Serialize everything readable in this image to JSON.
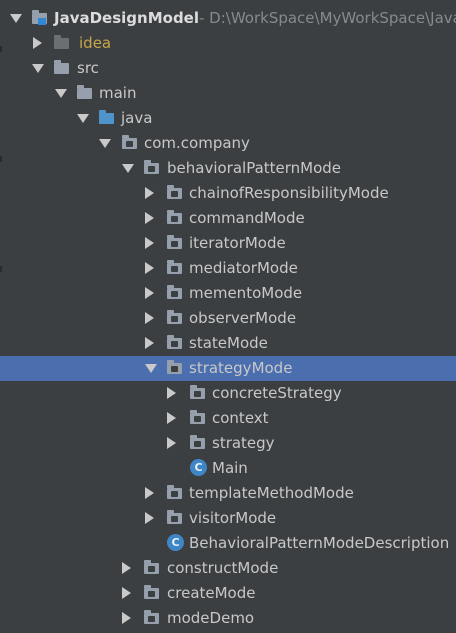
{
  "tree": {
    "project": {
      "name": "JavaDesignModel",
      "path": "- D:\\WorkSpace\\MyWorkSpace\\Java"
    },
    "items": [
      {
        "label": "idea",
        "kind": "folder-idea"
      },
      {
        "label": "src",
        "kind": "folder"
      },
      {
        "label": "main",
        "kind": "folder"
      },
      {
        "label": "java",
        "kind": "folder-source"
      },
      {
        "label": "com.company",
        "kind": "package"
      },
      {
        "label": "behavioralPatternMode",
        "kind": "package"
      },
      {
        "label": "chainofResponsibilityMode",
        "kind": "package"
      },
      {
        "label": "commandMode",
        "kind": "package"
      },
      {
        "label": "iteratorMode",
        "kind": "package"
      },
      {
        "label": "mediatorMode",
        "kind": "package"
      },
      {
        "label": "mementoMode",
        "kind": "package"
      },
      {
        "label": "observerMode",
        "kind": "package"
      },
      {
        "label": "stateMode",
        "kind": "package"
      },
      {
        "label": "strategyMode",
        "kind": "package",
        "selected": true
      },
      {
        "label": "concreteStrategy",
        "kind": "package"
      },
      {
        "label": "context",
        "kind": "package"
      },
      {
        "label": "strategy",
        "kind": "package"
      },
      {
        "label": "Main",
        "kind": "class"
      },
      {
        "label": "templateMethodMode",
        "kind": "package"
      },
      {
        "label": "visitorMode",
        "kind": "package"
      },
      {
        "label": "BehavioralPatternModeDescription",
        "kind": "class"
      },
      {
        "label": "constructMode",
        "kind": "package"
      },
      {
        "label": "createMode",
        "kind": "package"
      },
      {
        "label": "modeDemo",
        "kind": "package"
      }
    ],
    "class_icon_glyph": "C",
    "colors": {
      "background": "#3c3f41",
      "selection": "#4b6eaf",
      "text": "#c8c8c8",
      "idea_text": "#c6a64a",
      "path_text": "#868a8e",
      "folder": "#96a0ad",
      "source_folder": "#4e93c9",
      "class_icon": "#3f86c6"
    }
  }
}
